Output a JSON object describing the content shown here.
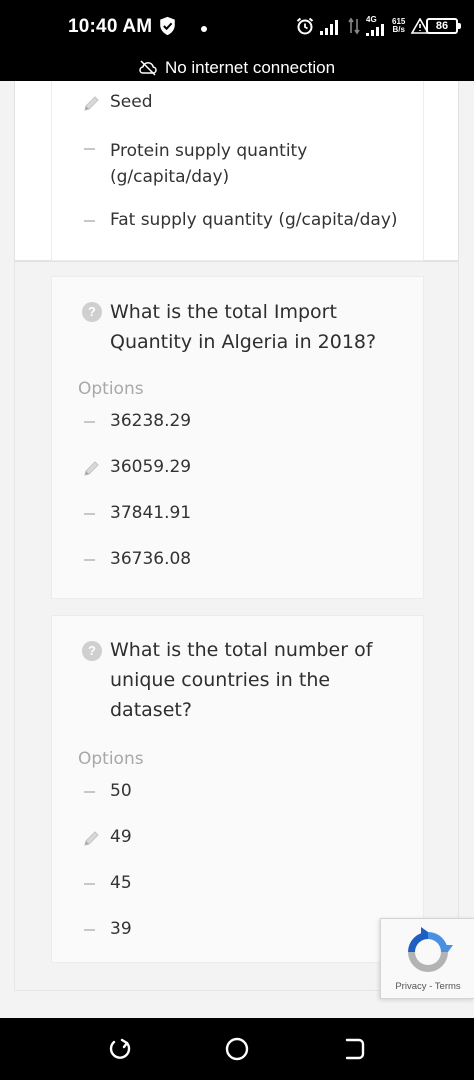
{
  "status_bar": {
    "time": "10:40 AM",
    "network_type": "4G",
    "speed_value": "615",
    "speed_unit": "B/s",
    "battery": "86",
    "connection_message": "No internet connection"
  },
  "options_card_top": {
    "options": [
      {
        "label": "Seed",
        "marker": "pencil-icon"
      },
      {
        "label": "Protein supply quantity (g/capita/day)",
        "marker": "dash"
      },
      {
        "label": "Fat supply quantity (g/capita/day)",
        "marker": "dash"
      }
    ]
  },
  "questions": [
    {
      "question": "What is the total Import Quantity in Algeria in 2018?",
      "options_heading": "Options",
      "options": [
        {
          "label": "36238.29",
          "marker": "dash"
        },
        {
          "label": "36059.29",
          "marker": "pencil-icon"
        },
        {
          "label": "37841.91",
          "marker": "dash"
        },
        {
          "label": "36736.08",
          "marker": "dash"
        }
      ]
    },
    {
      "question": "What is the total number of unique countries in the dataset?",
      "options_heading": "Options",
      "options": [
        {
          "label": "50",
          "marker": "dash"
        },
        {
          "label": "49",
          "marker": "pencil-icon"
        },
        {
          "label": "45",
          "marker": "dash"
        },
        {
          "label": "39",
          "marker": "dash"
        }
      ]
    }
  ],
  "recaptcha": {
    "privacy_label": "Privacy",
    "separator": "-",
    "terms_label": "Terms"
  },
  "colors": {
    "accent_blue": "#4a90e2",
    "recaptcha_grey": "#b3b3b3"
  }
}
